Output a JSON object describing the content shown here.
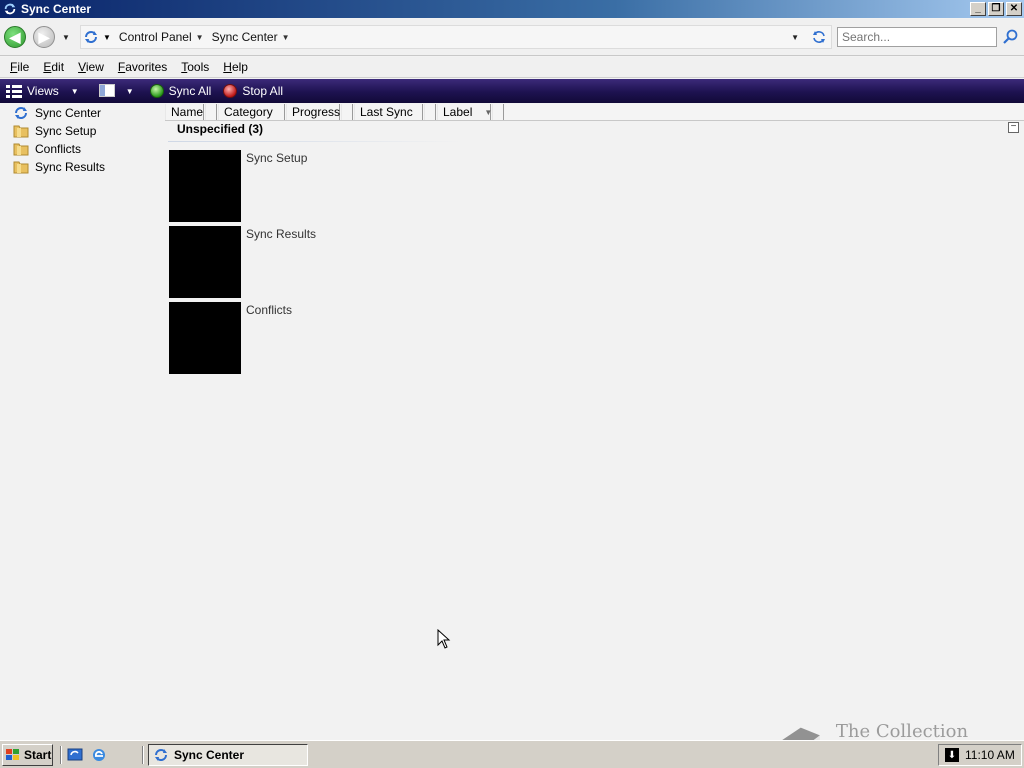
{
  "window": {
    "title": "Sync Center",
    "buttons": {
      "minimize": "_",
      "restore": "❐",
      "close": "✕"
    }
  },
  "address_bar": {
    "breadcrumbs": [
      "Control Panel",
      "Sync Center"
    ],
    "search_placeholder": "Search..."
  },
  "menu": {
    "items": [
      {
        "label": "File",
        "accel": "F",
        "rest": "ile"
      },
      {
        "label": "Edit",
        "accel": "E",
        "rest": "dit"
      },
      {
        "label": "View",
        "accel": "V",
        "rest": "iew"
      },
      {
        "label": "Favorites",
        "accel": "F",
        "rest": "avorites"
      },
      {
        "label": "Tools",
        "accel": "T",
        "rest": "ools"
      },
      {
        "label": "Help",
        "accel": "H",
        "rest": "elp"
      }
    ]
  },
  "command_bar": {
    "views_label": "Views",
    "sync_all_label": "Sync All",
    "stop_all_label": "Stop All"
  },
  "sidebar": {
    "items": [
      {
        "label": "Sync Center",
        "icon": "sync-icon"
      },
      {
        "label": "Sync Setup",
        "icon": "folder-icon"
      },
      {
        "label": "Conflicts",
        "icon": "folder-icon"
      },
      {
        "label": "Sync Results",
        "icon": "folder-icon"
      }
    ]
  },
  "columns": [
    "Name",
    "Category",
    "Progress",
    "Last Sync",
    "Label"
  ],
  "group": {
    "header": "Unspecified (3)",
    "collapse_symbol": "−",
    "items": [
      {
        "label": "Sync Setup"
      },
      {
        "label": "Sync Results"
      },
      {
        "label": "Conflicts"
      }
    ]
  },
  "watermark": {
    "text": "The Collection Book"
  },
  "taskbar": {
    "start_label": "Start",
    "task_label": "Sync Center",
    "clock": "11:10 AM"
  },
  "colors": {
    "title_gradient_start": "#0a246a",
    "command_bar": "#1d1250",
    "taskbar": "#d4d0c8"
  }
}
